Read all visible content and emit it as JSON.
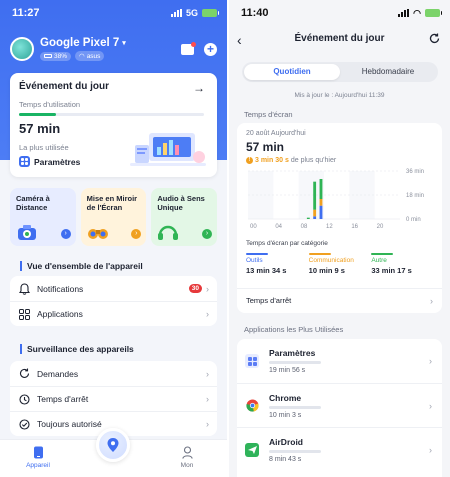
{
  "left": {
    "status": {
      "time": "11:27",
      "network": "5G"
    },
    "device": {
      "name": "Google Pixel 7",
      "battery": "38%",
      "wifi": "asus"
    },
    "event_card": {
      "title": "Événement du jour",
      "usage_label": "Temps d'utilisation",
      "usage_time": "57 min",
      "usage_fraction": 0.2,
      "most_used_label": "La plus utilisée",
      "most_used_app": "Paramètres"
    },
    "features": [
      {
        "label": "Caméra à Distance",
        "icon": "camera-icon"
      },
      {
        "label": "Mise en Miroir de l'Écran",
        "icon": "binoculars-icon"
      },
      {
        "label": "Audio à Sens Unique",
        "icon": "headphones-icon"
      }
    ],
    "overview": {
      "title": "Vue d'ensemble de l'appareil",
      "items": [
        {
          "label": "Notifications",
          "badge": "30",
          "icon": "bell-icon"
        },
        {
          "label": "Applications",
          "icon": "apps-grid-icon"
        }
      ]
    },
    "monitoring": {
      "title": "Surveillance des appareils",
      "items": [
        {
          "label": "Demandes",
          "icon": "refresh-icon"
        },
        {
          "label": "Temps d'arrêt",
          "icon": "clock-icon"
        },
        {
          "label": "Toujours autorisé",
          "icon": "check-circle-icon"
        }
      ]
    },
    "tabbar": {
      "device_label": "Appareil",
      "me_label": "Mon"
    }
  },
  "right": {
    "status": {
      "time": "11:40"
    },
    "nav_title": "Événement du jour",
    "segments": [
      "Quotidien",
      "Hebdomadaire"
    ],
    "active_segment": 0,
    "updated": "Mis à jour le : Aujourd'hui 11:39",
    "screen_time_label": "Temps d'écran",
    "screen_card": {
      "date": "20 août Aujourd'hui",
      "total": "57 min",
      "delta_value": "3 min 30 s",
      "delta_text": "de plus qu'hier",
      "category_title": "Temps d'écran par catégorie",
      "categories": [
        {
          "name": "Outils",
          "time": "13 min 34 s",
          "color": "#3f6ef0"
        },
        {
          "name": "Communication",
          "time": "10 min 9 s",
          "color": "#f0a020"
        },
        {
          "name": "Autre",
          "time": "33 min 17 s",
          "color": "#30b455"
        }
      ],
      "downtime_label": "Temps d'arrêt"
    },
    "apps_label": "Applications les Plus Utilisées",
    "apps": [
      {
        "name": "Paramètres",
        "time": "19 min 56 s",
        "icon": "settings-app-icon",
        "color": "#5b7cf5"
      },
      {
        "name": "Chrome",
        "time": "10 min 3 s",
        "icon": "chrome-icon",
        "color": "#e8453c"
      },
      {
        "name": "AirDroid",
        "time": "8 min 43 s",
        "icon": "airdroid-icon",
        "color": "#2fb35a"
      }
    ]
  },
  "chart_data": {
    "type": "bar",
    "x_ticks": [
      "00",
      "04",
      "08",
      "12",
      "16",
      "20"
    ],
    "y_ticks": [
      "36 min",
      "18 min",
      "0 min"
    ],
    "ylim": [
      0,
      36
    ],
    "bars": [
      {
        "hour": 9,
        "segments": [
          {
            "category": "Autre",
            "minutes": 1
          }
        ]
      },
      {
        "hour": 10,
        "segments": [
          {
            "category": "Outils",
            "minutes": 2
          },
          {
            "category": "Communication",
            "minutes": 5
          },
          {
            "category": "Autre",
            "minutes": 21
          }
        ]
      },
      {
        "hour": 11,
        "segments": [
          {
            "category": "Outils",
            "minutes": 10
          },
          {
            "category": "Communication",
            "minutes": 5
          },
          {
            "category": "Autre",
            "minutes": 15
          }
        ]
      }
    ],
    "category_colors": {
      "Outils": "#3f6ef0",
      "Communication": "#f0a020",
      "Autre": "#30b455"
    }
  }
}
